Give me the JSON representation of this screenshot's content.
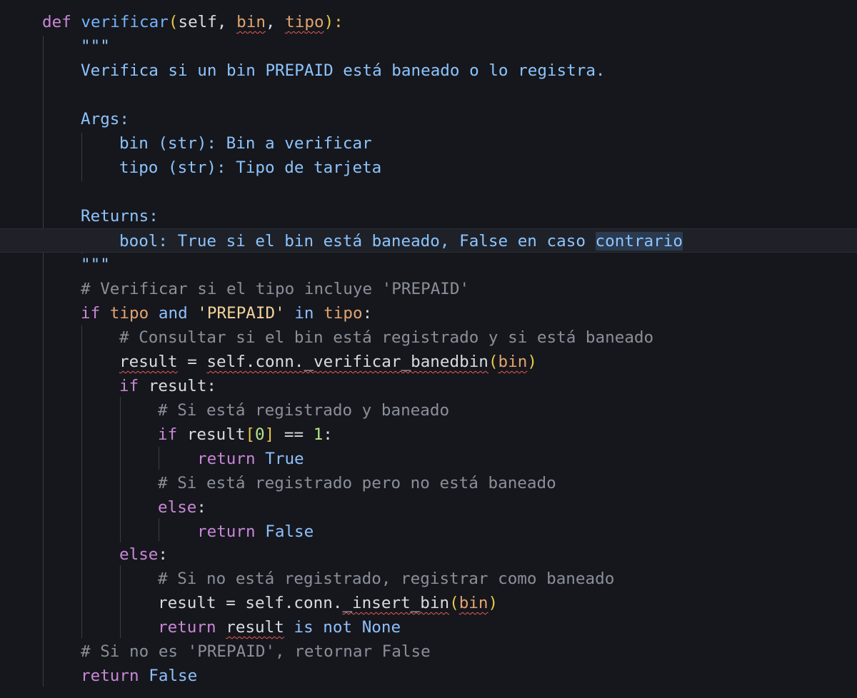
{
  "editor": {
    "language": "python",
    "current_line_index": 9
  },
  "code": {
    "l1_def": "def",
    "l1_name": "verificar",
    "l1_open": "(",
    "l1_self": "self",
    "l1_sep1": ", ",
    "l1_bin": "bin",
    "l1_sep2": ", ",
    "l1_tipo": "tipo",
    "l1_close": "):",
    "l2": "\"\"\"",
    "l3": "Verifica si un bin PREPAID está baneado o lo registra.",
    "l5": "Args:",
    "l6": "bin (str): Bin a verificar",
    "l7": "tipo (str): Tipo de tarjeta",
    "l9": "Returns:",
    "l10a": "bool: True si el bin está baneado, False en caso ",
    "l10b": "contrario",
    "l11": "\"\"\"",
    "l12": "# Verificar si el tipo incluye 'PREPAID'",
    "l13_if": "if",
    "l13_tipo1": "tipo",
    "l13_and": "and",
    "l13_str": "'PREPAID'",
    "l13_in": "in",
    "l13_tipo2": "tipo",
    "l13_colon": ":",
    "l14": "# Consultar si el bin está registrado y si está baneado",
    "l15_result": "result",
    "l15_eq": " = ",
    "l15_call": "self.conn._verificar_banedbin",
    "l15_open": "(",
    "l15_bin": "bin",
    "l15_close": ")",
    "l16_if": "if",
    "l16_rest": " result:",
    "l17": "# Si está registrado y baneado",
    "l18_if": "if",
    "l18_result": " result",
    "l18_lb": "[",
    "l18_zero": "0",
    "l18_rb": "]",
    "l18_eq": " == ",
    "l18_one": "1",
    "l18_colon": ":",
    "l19_return": "return",
    "l19_true": "True",
    "l20": "# Si está registrado pero no está baneado",
    "l21_else": "else",
    "l21_colon": ":",
    "l22_return": "return",
    "l22_false": "False",
    "l23_else": "else",
    "l23_colon": ":",
    "l24": "# Si no está registrado, registrar como baneado",
    "l25_lhs": "result = self.conn.",
    "l25_fn": "_insert_bin",
    "l25_open": "(",
    "l25_bin": "bin",
    "l25_close": ")",
    "l26_return": "return",
    "l26_result": "result",
    "l26_isnot": "is not",
    "l26_none": "None",
    "l27": "# Si no es 'PREPAID', retornar False",
    "l28_return": "return",
    "l28_false": "False"
  }
}
